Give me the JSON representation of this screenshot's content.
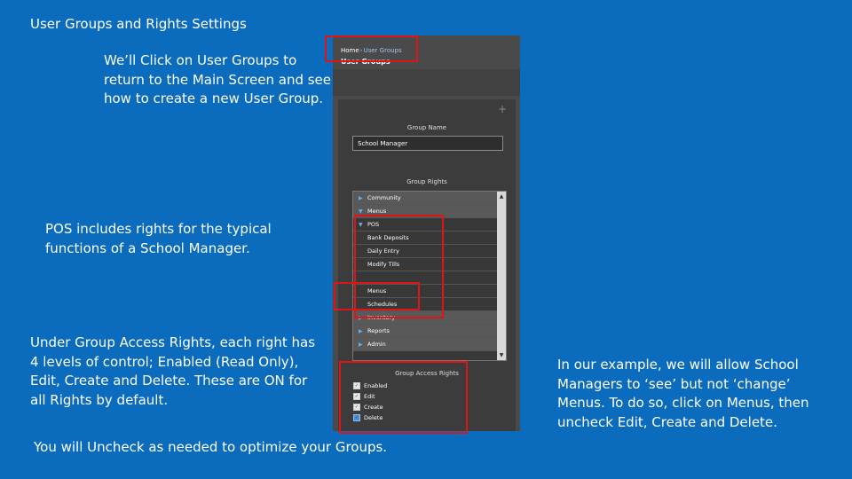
{
  "slide": {
    "title": "User Groups and Rights Settings",
    "notes": {
      "note_1": "We’ll Click on User Groups to return to the Main Screen and see how to create a new User Group.",
      "note_2": "POS includes rights for the typical functions of a School Manager.",
      "note_3": "Under Group Access Rights, each right has 4 levels of control; Enabled (Read Only), Edit, Create and Delete. These are ON for all Rights by default.",
      "note_4": "In our example, we will allow School Managers to ‘see’ but not ‘change’ Menus. To do so, click on Menus, then uncheck Edit, Create and Delete.",
      "note_5": "You will Uncheck as needed to optimize your Groups."
    }
  },
  "screenshot": {
    "breadcrumb": {
      "home": "Home",
      "separator": "›",
      "current": "User Groups"
    },
    "page_heading": "User Groups",
    "group_name_label": "Group Name",
    "group_name_value": "School Manager",
    "group_rights_label": "Group Rights",
    "rights": [
      {
        "label": "Community",
        "type": "category"
      },
      {
        "label": "Menus",
        "type": "category"
      },
      {
        "label": "POS",
        "type": "category"
      },
      {
        "label": "Bank Deposits",
        "type": "sub"
      },
      {
        "label": "Daily Entry",
        "type": "sub"
      },
      {
        "label": "Modify Tills",
        "type": "sub"
      },
      {
        "label": "",
        "type": "sub"
      },
      {
        "label": "Menus",
        "type": "sub"
      },
      {
        "label": "Schedules",
        "type": "sub"
      },
      {
        "label": "Inventory",
        "type": "category"
      },
      {
        "label": "Reports",
        "type": "category"
      },
      {
        "label": "Admin",
        "type": "category"
      }
    ],
    "group_access_rights_label": "Group Access Rights",
    "access_rights": [
      {
        "label": "Enabled",
        "checked": true
      },
      {
        "label": "Edit",
        "checked": true
      },
      {
        "label": "Create",
        "checked": true
      },
      {
        "label": "Delete",
        "checked": true
      }
    ]
  },
  "colors": {
    "slide_background": "#0b6bbd",
    "panel_background": "#4a4a4a",
    "highlight_red": "#e01414",
    "link_blue": "#9ec6f0"
  },
  "icons": {
    "add": "plus-icon",
    "expand": "triangle-right-icon",
    "scroll_up": "arrow-up-icon",
    "scroll_down": "arrow-down-icon"
  }
}
